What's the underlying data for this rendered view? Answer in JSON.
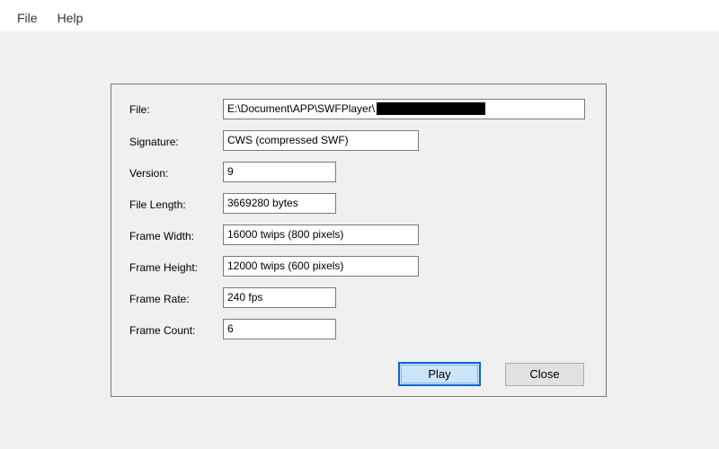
{
  "menu": {
    "items": [
      {
        "label": "File"
      },
      {
        "label": "Help"
      }
    ]
  },
  "info": {
    "file_label": "File:",
    "file_value": "E:\\Document\\APP\\SWFPlayer\\",
    "signature_label": "Signature:",
    "signature_value": "CWS (compressed SWF)",
    "version_label": "Version:",
    "version_value": "9",
    "file_length_label": "File Length:",
    "file_length_value": "3669280 bytes",
    "frame_width_label": "Frame Width:",
    "frame_width_value": "16000 twips (800 pixels)",
    "frame_height_label": "Frame Height:",
    "frame_height_value": "12000 twips (600 pixels)",
    "frame_rate_label": "Frame Rate:",
    "frame_rate_value": "240 fps",
    "frame_count_label": "Frame Count:",
    "frame_count_value": "6"
  },
  "buttons": {
    "play_label": "Play",
    "close_label": "Close"
  },
  "colors": {
    "accent": "#0a64d8",
    "play_fill": "#cce4f7",
    "background": "#f0f0f0"
  }
}
